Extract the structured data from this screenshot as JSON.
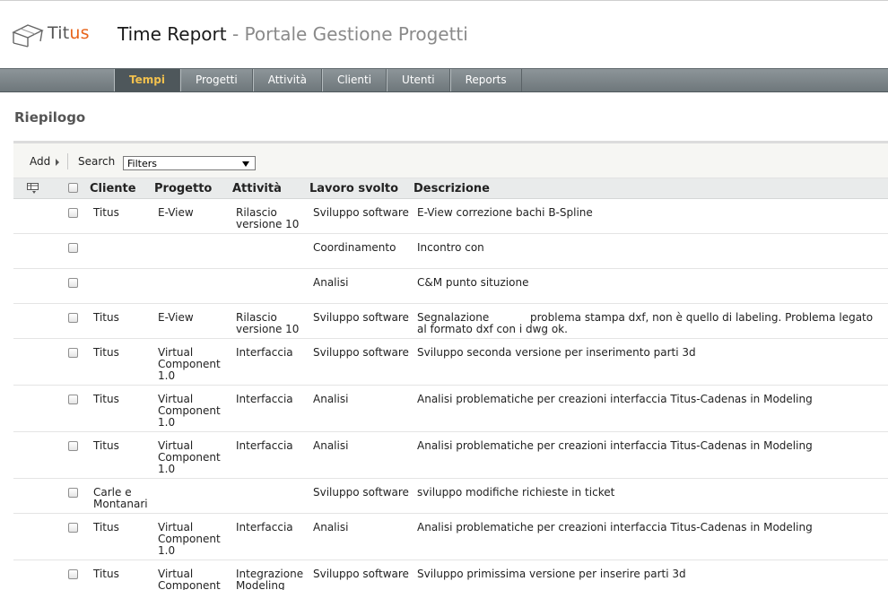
{
  "header": {
    "logo_text_prefix": "Tit",
    "logo_text_accent": "us",
    "title_main": "Time Report",
    "title_sub": " - Portale Gestione Progetti"
  },
  "nav": {
    "items": [
      "Tempi",
      "Progetti",
      "Attività",
      "Clienti",
      "Utenti",
      "Reports"
    ],
    "active": "Tempi"
  },
  "page": {
    "section_title": "Riepilogo"
  },
  "toolbar": {
    "add_label": "Add",
    "search_label": "Search",
    "filter_value": "Filters"
  },
  "table": {
    "headers": {
      "cliente": "Cliente",
      "progetto": "Progetto",
      "attivita": "Attività",
      "lavoro": "Lavoro svolto",
      "descrizione": "Descrizione"
    },
    "rows": [
      {
        "cliente": "Titus",
        "progetto": "E-View",
        "attivita": "Rilascio versione 10",
        "lavoro": "Sviluppo software",
        "descrizione": "E-View correzione bachi B-Spline"
      },
      {
        "cliente": "",
        "progetto": "",
        "attivita": "",
        "lavoro": "Coordinamento",
        "descrizione": "Incontro con"
      },
      {
        "cliente": "",
        "progetto": "",
        "attivita": "",
        "lavoro": "Analisi",
        "descrizione": "C&M punto situzione"
      },
      {
        "cliente": "Titus",
        "progetto": "E-View",
        "attivita": "Rilascio versione 10",
        "lavoro": "Sviluppo software",
        "descrizione": "Segnalazione            problema stampa dxf, non è quello di labeling. Problema legato al formato dxf con i dwg ok."
      },
      {
        "cliente": "Titus",
        "progetto": "Virtual Component 1.0",
        "attivita": "Interfaccia",
        "lavoro": "Sviluppo software",
        "descrizione": "Sviluppo seconda versione per inserimento parti 3d"
      },
      {
        "cliente": "Titus",
        "progetto": "Virtual Component 1.0",
        "attivita": "Interfaccia",
        "lavoro": "Analisi",
        "descrizione": "Analisi problematiche per creazioni interfaccia Titus-Cadenas in Modeling"
      },
      {
        "cliente": "Titus",
        "progetto": "Virtual Component 1.0",
        "attivita": "Interfaccia",
        "lavoro": "Analisi",
        "descrizione": "Analisi problematiche per creazioni interfaccia Titus-Cadenas in Modeling"
      },
      {
        "cliente": "Carle e Montanari",
        "progetto": "",
        "attivita": "",
        "lavoro": "Sviluppo software",
        "descrizione": "sviluppo modifiche richieste in ticket"
      },
      {
        "cliente": "Titus",
        "progetto": "Virtual Component 1.0",
        "attivita": "Interfaccia",
        "lavoro": "Analisi",
        "descrizione": "Analisi problematiche per creazioni interfaccia Titus-Cadenas in Modeling"
      },
      {
        "cliente": "Titus",
        "progetto": "Virtual Component",
        "attivita": "Integrazione Modeling",
        "lavoro": "Sviluppo software",
        "descrizione": "Sviluppo primissima versione per inserire parti 3d"
      }
    ]
  }
}
